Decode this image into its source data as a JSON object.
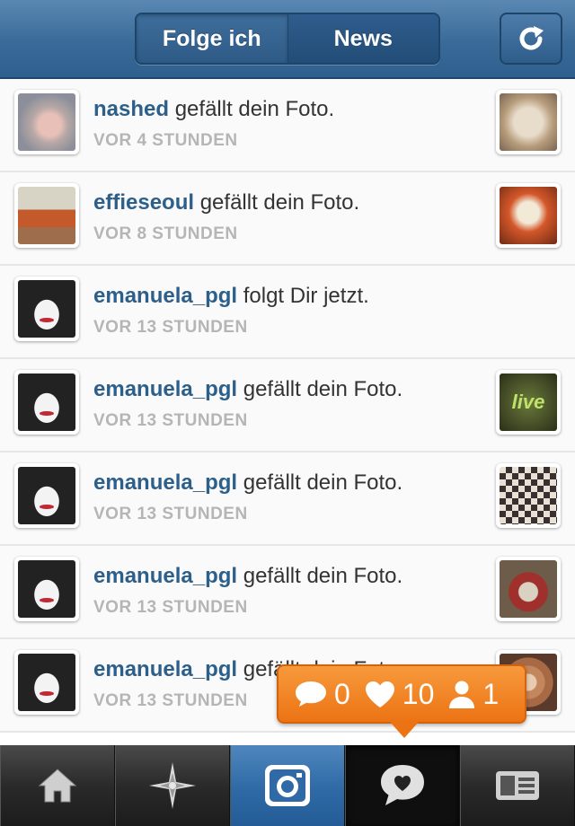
{
  "header": {
    "tabs": [
      {
        "label": "Folge ich"
      },
      {
        "label": "News"
      }
    ]
  },
  "feed": [
    {
      "user": "nashed",
      "action": "gefällt dein Foto.",
      "time": "VOR 4 STUNDEN"
    },
    {
      "user": "effieseoul",
      "action": "gefällt dein Foto.",
      "time": "VOR 8 STUNDEN"
    },
    {
      "user": "emanuela_pgl",
      "action": "folgt Dir jetzt.",
      "time": "VOR 13 STUNDEN"
    },
    {
      "user": "emanuela_pgl",
      "action": "gefällt dein Foto.",
      "time": "VOR 13 STUNDEN"
    },
    {
      "user": "emanuela_pgl",
      "action": "gefällt dein Foto.",
      "time": "VOR 13 STUNDEN"
    },
    {
      "user": "emanuela_pgl",
      "action": "gefällt dein Foto.",
      "time": "VOR 13 STUNDEN"
    },
    {
      "user": "emanuela_pgl",
      "action": "gefällt dein Foto.",
      "time": "VOR 13 STUNDEN"
    }
  ],
  "thumbnails": [
    "bread",
    "milk",
    "",
    "live",
    "checker",
    "tv",
    "plate"
  ],
  "thumb_text": {
    "live": "live"
  },
  "notification_bubble": {
    "comments": "0",
    "likes": "10",
    "followers": "1",
    "color": "#f08020"
  },
  "tabbar": {
    "items": [
      "home-icon",
      "explore-star-icon",
      "camera-icon",
      "news-heart-bubble-icon",
      "profile-card-icon"
    ],
    "active": "news-heart-bubble-icon"
  },
  "colors": {
    "header": "#3a6a98",
    "username": "#2d5f8b",
    "timestamp": "#b5b5b5"
  }
}
